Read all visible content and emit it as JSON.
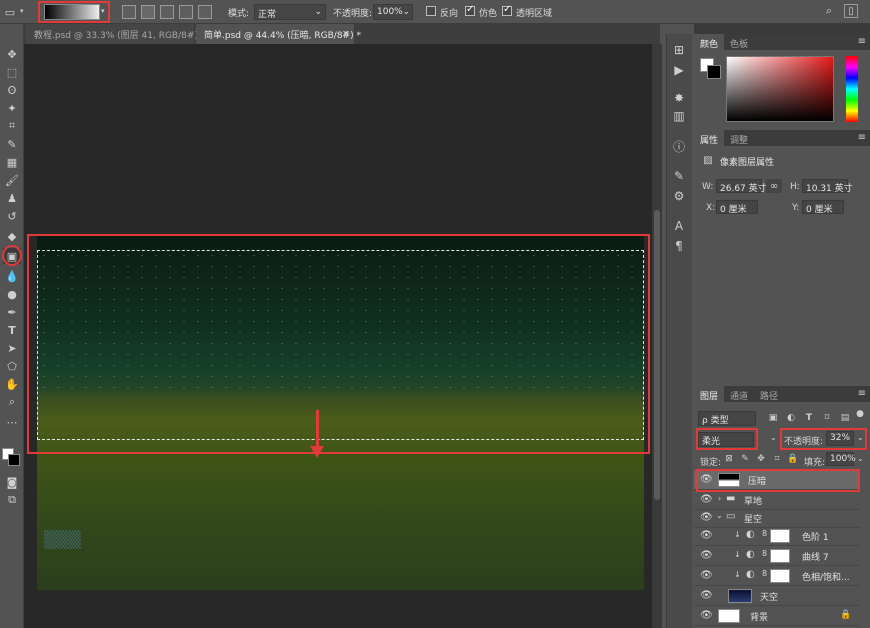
{
  "options": {
    "mode_label": "模式:",
    "mode_value": "正常",
    "opacity_label": "不透明度:",
    "opacity_value": "100%",
    "reverse_label": "反向",
    "dither_label": "仿色",
    "transparency_label": "透明区域",
    "reverse_checked": false,
    "dither_checked": true,
    "transparency_checked": true
  },
  "tabs": [
    {
      "label": "教程.psd @ 33.3% (图层 41, RGB/8#)",
      "active": false
    },
    {
      "label": "简单.psd @ 44.4% (压暗, RGB/8#) *",
      "active": true
    }
  ],
  "color_panel": {
    "tabs": [
      "颜色",
      "色板"
    ],
    "fg_color": "#ffffff",
    "bg_color": "#000000",
    "spectrum_hue": "#e51a1a"
  },
  "properties_panel": {
    "tabs": [
      "属性",
      "调整"
    ],
    "title": "像素图层属性",
    "w_label": "W:",
    "w_value": "26.67 英寸",
    "h_label": "H:",
    "h_value": "10.31 英寸",
    "x_label": "X:",
    "x_value": "0 厘米",
    "y_label": "Y:",
    "y_value": "0 厘米"
  },
  "layers_panel": {
    "tabs": [
      "图层",
      "通道",
      "路径"
    ],
    "filter_label": "ρ 类型",
    "blend_mode": "柔光",
    "opacity_label": "不透明度:",
    "opacity_value": "32%",
    "lock_label": "锁定:",
    "fill_label": "填充:",
    "fill_value": "100%",
    "layers": [
      {
        "name": "压暗",
        "type": "pixel",
        "selected": true
      },
      {
        "name": "草地",
        "type": "group"
      },
      {
        "name": "星空",
        "type": "group-open"
      },
      {
        "name": "色阶 1",
        "type": "adjustment"
      },
      {
        "name": "曲线 7",
        "type": "adjustment"
      },
      {
        "name": "色相/饱和...",
        "type": "adjustment"
      },
      {
        "name": "天空",
        "type": "pixel"
      },
      {
        "name": "背景",
        "type": "background"
      }
    ]
  },
  "accent_color": "#e03a3a"
}
